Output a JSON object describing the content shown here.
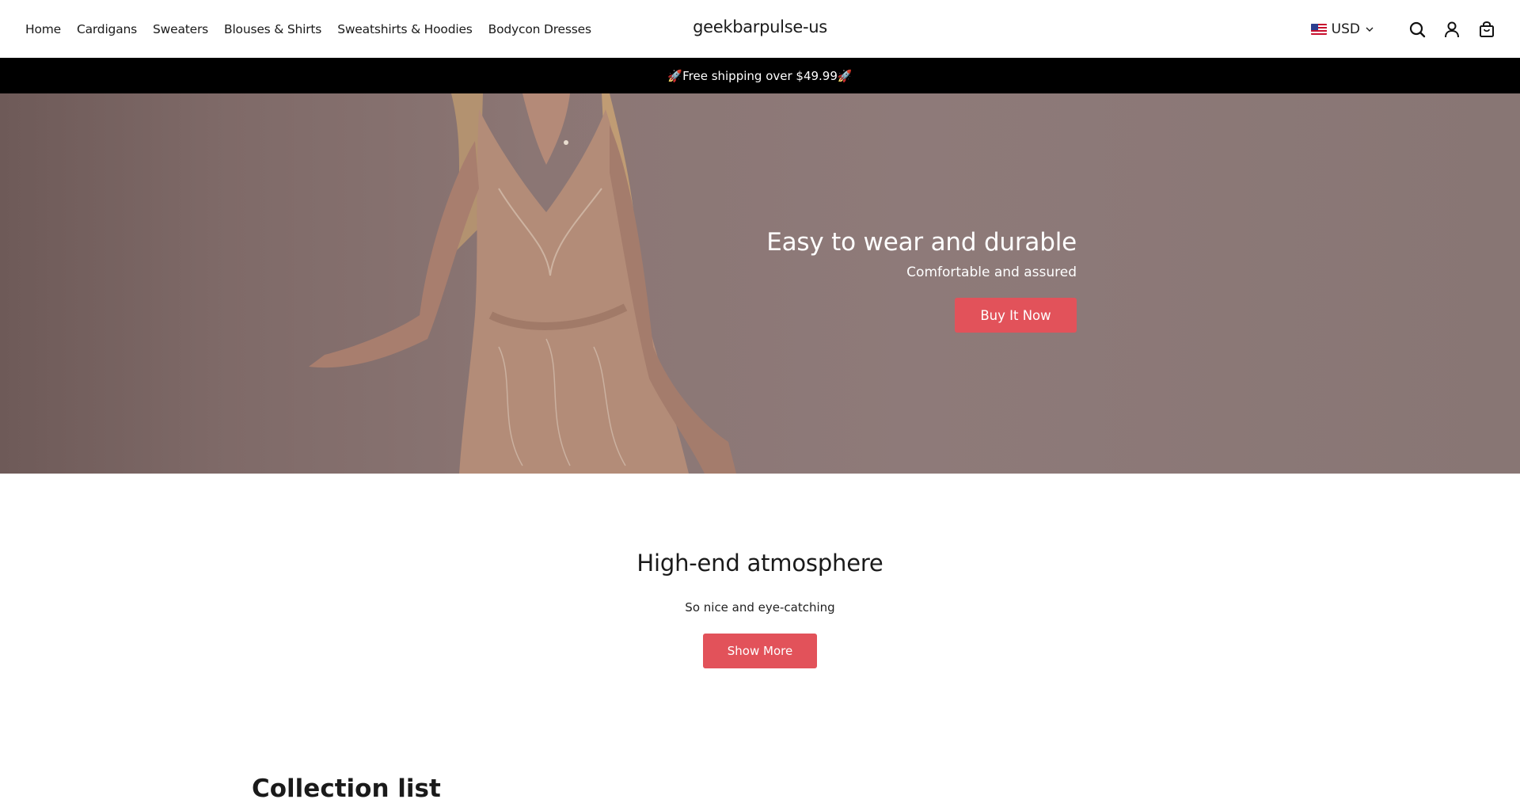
{
  "header": {
    "nav": [
      "Home",
      "Cardigans",
      "Sweaters",
      "Blouses & Shirts",
      "Sweatshirts & Hoodies",
      "Bodycon Dresses"
    ],
    "brand": "geekbarpulse-us",
    "currency": "USD",
    "icons": [
      "flag-us-icon",
      "chevron-down-icon",
      "search-icon",
      "account-icon",
      "cart-icon"
    ]
  },
  "announcement": {
    "text": "🚀Free shipping over $49.99🚀"
  },
  "hero": {
    "title": "Easy to wear and durable",
    "subtitle": "Comfortable and assured",
    "button": "Buy It Now"
  },
  "feature": {
    "title": "High-end atmosphere",
    "subtitle": "So nice and eye-catching",
    "button": "Show More"
  },
  "collection": {
    "title": "Collection list"
  },
  "colors": {
    "accent": "#e2525a",
    "announcement_bg": "#000000",
    "hero_bg": "#8b7674"
  }
}
